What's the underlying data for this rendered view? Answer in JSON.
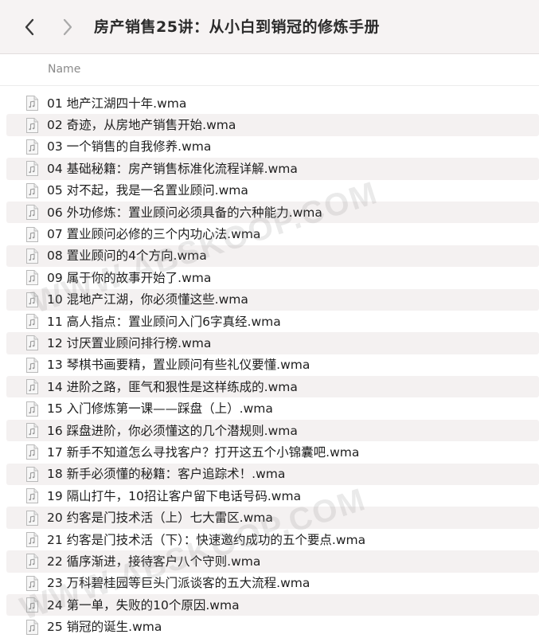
{
  "toolbar": {
    "title": "房产销售25讲：从小白到销冠的修炼手册"
  },
  "columns": {
    "name": "Name"
  },
  "files": [
    "01 地产江湖四十年.wma",
    "02 奇迹，从房地产销售开始.wma",
    "03 一个销售的自我修养.wma",
    "04 基础秘籍：房产销售标准化流程详解.wma",
    "05 对不起，我是一名置业顾问.wma",
    "06 外功修炼：置业顾问必须具备的六种能力.wma",
    "07 置业顾问必修的三个内功心法.wma",
    "08 置业顾问的4个方向.wma",
    "09 属于你的故事开始了.wma",
    "10 混地产江湖，你必须懂这些.wma",
    "11 高人指点：置业顾问入门6字真经.wma",
    "12 讨厌置业顾问排行榜.wma",
    "13 琴棋书画要精，置业顾问有些礼仪要懂.wma",
    "14 进阶之路，匪气和狠性是这样练成的.wma",
    "15 入门修炼第一课——踩盘（上）.wma",
    "16 踩盘进阶，你必须懂这的几个潜规则.wma",
    "17 新手不知道怎么寻找客户？打开这五个小锦囊吧.wma",
    "18 新手必须懂的秘籍：客户追踪术！.wma",
    "19 隔山打牛，10招让客户留下电话号码.wma",
    "20 约客是门技术活（上）七大雷区.wma",
    "21 约客是门技术活（下）：快速邀约成功的五个要点.wma",
    "22 循序渐进，接待客户八个守则.wma",
    "23 万科碧桂园等巨头门派谈客的五大流程.wma",
    "24 第一单，失败的10个原因.wma",
    "25 销冠的诞生.wma"
  ],
  "icons": {
    "back": "chevron-left-icon",
    "forward": "chevron-right-icon",
    "file": "audio-file-icon"
  },
  "watermark": {
    "text": "WWW.ABSKOOP.COM"
  },
  "colors": {
    "toolbar_bg": "#f6f3f3",
    "stripe_bg": "#f4f1f1",
    "header_text": "#8a8a8a"
  }
}
